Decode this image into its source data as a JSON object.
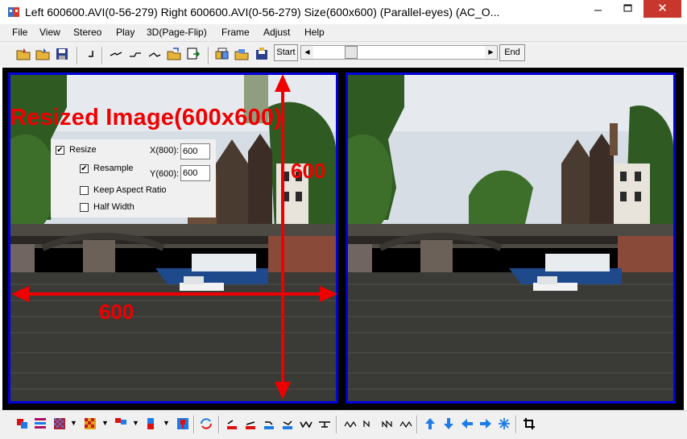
{
  "window": {
    "title": "Left 600600.AVI(0-56-279) Right 600600.AVI(0-56-279) Size(600x600)  (Parallel-eyes) (AC_O...",
    "close_glyph": "✕"
  },
  "menu": {
    "items": [
      "File",
      "View",
      "Stereo",
      "Play",
      "3D(Page-Flip)",
      "Frame",
      "Adjust",
      "Help"
    ]
  },
  "toolbar": {
    "start_label": "Start",
    "end_label": "End",
    "scroll_left_glyph": "◀",
    "scroll_right_glyph": "▶",
    "icons": [
      "open-folder-icon",
      "open-folder-icon",
      "save-icon",
      "bracket-icon",
      "line-icon",
      "line-icon",
      "line-icon",
      "folder-arrow-icon",
      "export-icon",
      "copy-icon",
      "open-stereo-icon",
      "save-stereo-icon"
    ]
  },
  "overlay": {
    "title": "Resized Image(600x600)",
    "width_label": "600",
    "height_label": "600"
  },
  "resize_panel": {
    "resize_label": "Resize",
    "resize_checked": true,
    "resample_label": "Resample",
    "resample_checked": true,
    "keep_aspect_label": "Keep Aspect Ratio",
    "keep_aspect_checked": false,
    "half_width_label": "Half Width",
    "half_width_checked": false,
    "x_label": "X(800):",
    "x_value": "600",
    "y_label": "Y(600):",
    "y_value": "600",
    "check_glyph": "✔"
  },
  "bottom_toolbar": {
    "dropdown_glyph": "▼",
    "icons": [
      "anaglyph-icon",
      "interlace-icon",
      "checker-icon",
      "mosaic-icon",
      "side-by-side-icon",
      "above-below-icon",
      "single-icon",
      "swap-icon",
      "align-icon",
      "arrow-up-icon",
      "arrow-down-icon",
      "arrow-left-icon",
      "arrow-right-icon",
      "reset-icon",
      "crop-icon"
    ],
    "arrow_color": "#1e7be8",
    "accent_red": "#e01010"
  },
  "colors": {
    "frame_border": "#0000d8",
    "overlay_red": "#ee0000"
  }
}
